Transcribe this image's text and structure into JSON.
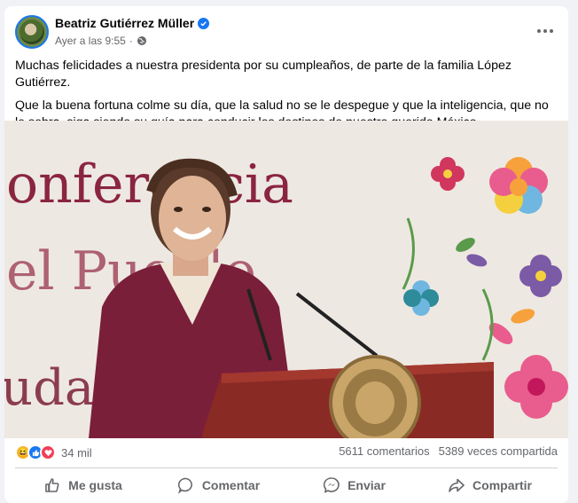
{
  "post": {
    "author": "Beatriz Gutiérrez Müller",
    "timestamp": "Ayer a las 9:55",
    "privacy_icon": "globe-icon",
    "paragraphs": [
      "Muchas felicidades a nuestra presidenta por su cumpleaños, de parte de la familia López Gutiérrez.",
      "Que la buena fortuna colme su día, que la salud no se le despegue y que la inteligencia, que no le sobra, siga siendo su guía para conducir los destinos de nuestro querido México."
    ],
    "photo_backdrop_text": [
      "onferencia",
      "el Pueblo",
      "udad"
    ]
  },
  "engagement": {
    "reaction_count": "34 mil",
    "comments": "5611 comentarios",
    "shares": "5389 veces compartida"
  },
  "actions": {
    "like": "Me gusta",
    "comment": "Comentar",
    "send": "Enviar",
    "share": "Compartir"
  },
  "colors": {
    "brand_blue": "#1877f2",
    "text_secondary": "#65676b",
    "jacket": "#7a1f3a",
    "podium": "#8a2a25"
  }
}
